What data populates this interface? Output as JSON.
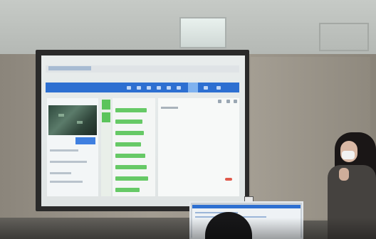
{
  "scene": {
    "type": "photo",
    "colors": {
      "nav_blue": "#2d6fd1",
      "accent_green": "#5bc45b",
      "badge_red": "#e05a4c"
    }
  }
}
